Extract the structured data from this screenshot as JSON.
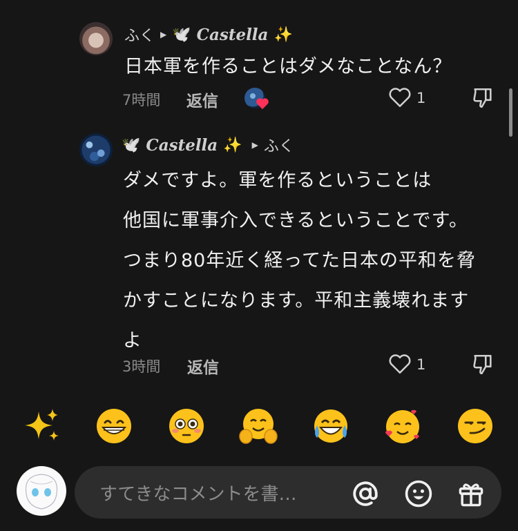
{
  "comment1": {
    "author": "ふく",
    "reply_to": "Castella",
    "text": "日本軍を作ることはダメなことなん？",
    "time": "7時間",
    "reply_label": "返信",
    "likes": "1"
  },
  "comment2": {
    "author": "Castella",
    "reply_to": "ふく",
    "lines": [
      "ダメですよ。軍を作るということは",
      "他国に軍事介入できるということです。",
      "つまり80年近く経ってた日本の平和を脅",
      "かすことになります。平和主義壊れます",
      "よ"
    ],
    "time": "3時間",
    "reply_label": "返信",
    "likes": "1"
  },
  "emoji_bar": [
    "sparkles",
    "grinning",
    "flushed",
    "hugging",
    "joy",
    "smiling-hearts",
    "smirk"
  ],
  "input": {
    "placeholder": "すてきなコメントを書…"
  },
  "colors": {
    "background": "#161616",
    "input_bg": "#2d2d2d",
    "heart_red": "#ff3158"
  }
}
